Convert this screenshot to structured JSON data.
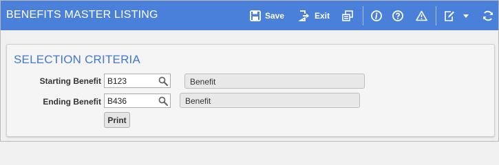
{
  "header": {
    "title": "BENEFITS MASTER LISTING",
    "save_label": "Save",
    "exit_label": "Exit",
    "icons": [
      "save-icon",
      "exit-icon",
      "print-queue-icon",
      "info-icon",
      "help-icon",
      "warning-icon",
      "notes-icon",
      "dropdown-caret-icon",
      "refresh-icon"
    ]
  },
  "criteria": {
    "title": "SELECTION CRITERIA",
    "starting": {
      "label": "Starting Benefit",
      "value": "B123",
      "description": "Benefit"
    },
    "ending": {
      "label": "Ending Benefit",
      "value": "B436",
      "description": "Benefit"
    },
    "print_label": "Print"
  },
  "colors": {
    "header_bg": "#4a80d9",
    "section_title": "#3f78d6"
  }
}
